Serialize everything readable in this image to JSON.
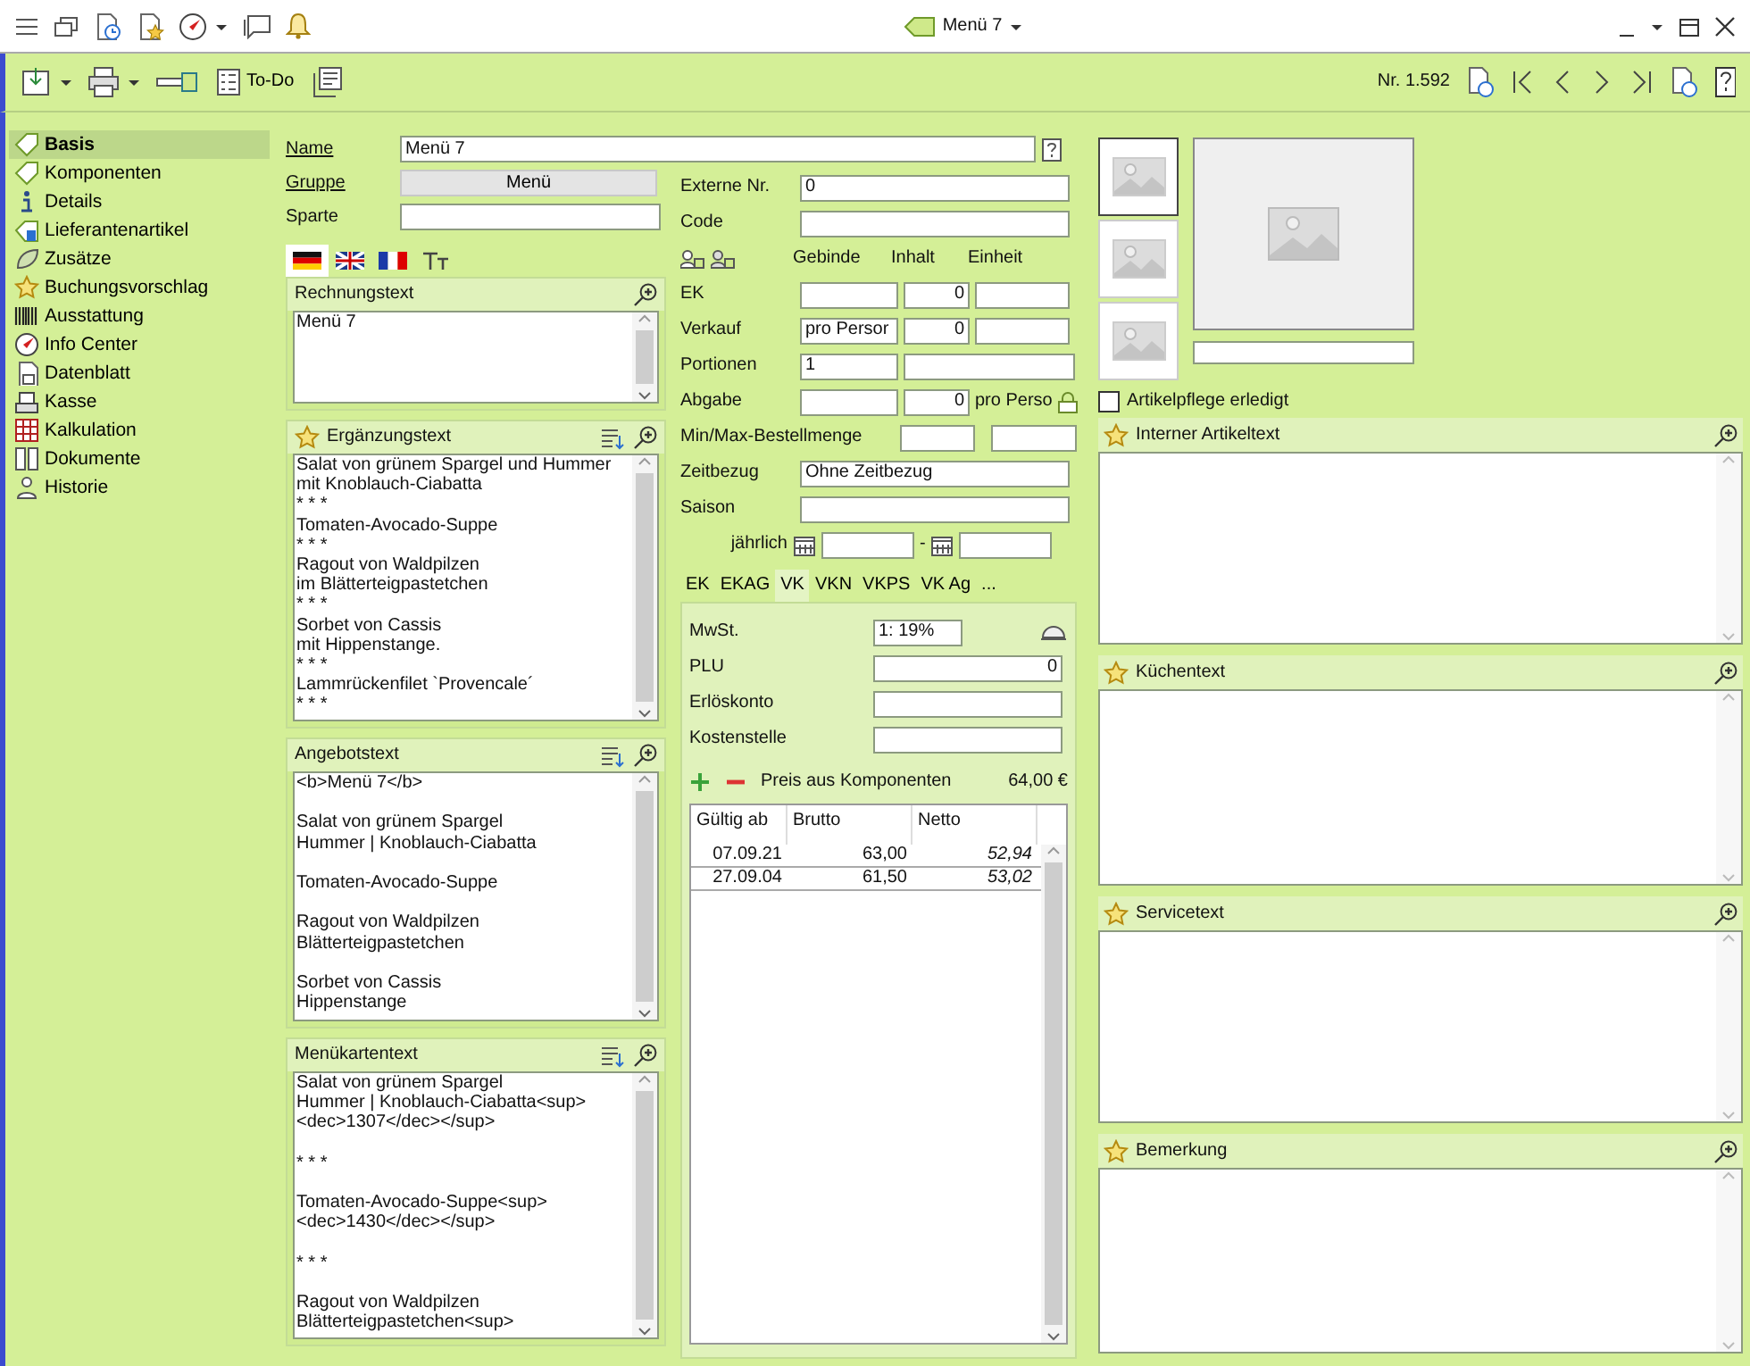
{
  "title_bar": {
    "title": "Menü 7"
  },
  "toolbar": {
    "todo_label": "To-Do",
    "record_number": "Nr. 1.592"
  },
  "sidebar": {
    "items": [
      {
        "label": "Basis",
        "kind": "tag",
        "selected": true
      },
      {
        "label": "Komponenten",
        "kind": "tag",
        "selected": false
      },
      {
        "label": "Details",
        "kind": "info",
        "selected": false
      },
      {
        "label": "Lieferantenartikel",
        "kind": "supplier",
        "selected": false
      },
      {
        "label": "Zusätze",
        "kind": "leaf",
        "selected": false
      },
      {
        "label": "Buchungsvorschlag",
        "kind": "star",
        "selected": false
      },
      {
        "label": "Ausstattung",
        "kind": "barcode",
        "selected": false
      },
      {
        "label": "Info Center",
        "kind": "compass",
        "selected": false
      },
      {
        "label": "Datenblatt",
        "kind": "sheet",
        "selected": false
      },
      {
        "label": "Kasse",
        "kind": "register",
        "selected": false
      },
      {
        "label": "Kalkulation",
        "kind": "grid",
        "selected": false
      },
      {
        "label": "Dokumente",
        "kind": "docs",
        "selected": false
      },
      {
        "label": "Historie",
        "kind": "history",
        "selected": false
      }
    ]
  },
  "form": {
    "name": {
      "label": "Name",
      "value": "Menü 7"
    },
    "group": {
      "label": "Gruppe",
      "value": "Menü"
    },
    "sparte": {
      "label": "Sparte"
    }
  },
  "language_tabs": [
    {
      "kind": "de",
      "selected": true
    },
    {
      "kind": "gb",
      "selected": false
    },
    {
      "kind": "fr",
      "selected": false
    },
    {
      "kind": "font",
      "selected": false
    }
  ],
  "text_panels": [
    {
      "title": "Rechnungstext",
      "starred": false,
      "sortable": false,
      "paragraphs": [
        [
          "Menü 7"
        ]
      ]
    },
    {
      "title": "Ergänzungstext",
      "starred": true,
      "sortable": true,
      "paragraphs": [
        [
          "Salat von grünem Spargel und Hummer",
          "mit Knoblauch-Ciabatta",
          "* * *",
          "Tomaten-Avocado-Suppe",
          "* * *",
          "Ragout von Waldpilzen",
          "im Blätterteigpastetchen",
          "* * *",
          "Sorbet von Cassis",
          "mit Hippenstange.",
          "* * *",
          "Lammrückenfilet `Provencale´",
          "* * *"
        ]
      ]
    },
    {
      "title": "Angebotstext",
      "starred": false,
      "sortable": true,
      "paragraphs": [
        [
          "<b>Menü 7</b>"
        ],
        [
          "Salat von grünem Spargel",
          "Hummer | Knoblauch-Ciabatta"
        ],
        [
          "Tomaten-Avocado-Suppe"
        ],
        [
          "Ragout von Waldpilzen",
          "Blätterteigpastetchen"
        ],
        [
          "Sorbet von Cassis",
          "Hippenstange"
        ]
      ]
    },
    {
      "title": "Menükartentext",
      "starred": false,
      "sortable": true,
      "paragraphs": [
        [
          "Salat von grünem Spargel",
          "Hummer | Knoblauch-Ciabatta<sup>",
          "<dec>1307</dec></sup>"
        ],
        [
          "* * *"
        ],
        [
          "Tomaten-Avocado-Suppe<sup>",
          "<dec>1430</dec></sup>"
        ],
        [
          "* * *"
        ],
        [
          "Ragout von Waldpilzen",
          "Blätterteigpastetchen<sup>"
        ]
      ]
    }
  ],
  "details": {
    "rows": [
      {
        "kind": "field",
        "label": "Externe Nr.",
        "value": "0"
      },
      {
        "kind": "field",
        "label": "Code"
      },
      {
        "kind": "header",
        "columns": [
          "Gebinde",
          "Inhalt",
          "Einheit"
        ]
      },
      {
        "kind": "measure",
        "label": "EK",
        "fields": [
          {
            "kind": "text"
          },
          {
            "kind": "number",
            "value": "0"
          },
          {
            "kind": "text"
          }
        ]
      },
      {
        "kind": "measure",
        "label": "Verkauf",
        "fields": [
          {
            "kind": "text",
            "value": "pro Persor"
          },
          {
            "kind": "number",
            "value": "0"
          },
          {
            "kind": "text"
          }
        ]
      },
      {
        "kind": "measure",
        "label": "Portionen",
        "fields": [
          {
            "kind": "text",
            "value": "1"
          },
          {
            "kind": "wide"
          }
        ]
      },
      {
        "kind": "measure",
        "label": "Abgabe",
        "fields": [
          {
            "kind": "text"
          },
          {
            "kind": "number",
            "value": "0"
          }
        ],
        "suffix": "pro Perso",
        "locked": true
      },
      {
        "kind": "minmax",
        "label": "Min/Max-Bestellmenge"
      },
      {
        "kind": "field",
        "label": "Zeitbezug",
        "value": "Ohne Zeitbezug"
      },
      {
        "kind": "field",
        "label": "Saison"
      },
      {
        "kind": "daterange",
        "label": "jährlich",
        "separator": "-"
      }
    ]
  },
  "price_tabs": [
    {
      "label": "EK",
      "selected": false
    },
    {
      "label": "EKAG",
      "selected": false
    },
    {
      "label": "VK",
      "selected": true
    },
    {
      "label": "VKN",
      "selected": false
    },
    {
      "label": "VKPS",
      "selected": false
    },
    {
      "label": "VK Ag",
      "selected": false
    },
    {
      "label": "...",
      "selected": false
    }
  ],
  "price_panel": {
    "fields": [
      {
        "label": "MwSt.",
        "kind": "select",
        "value": "1: 19%"
      },
      {
        "label": "PLU",
        "kind": "number",
        "value": "0"
      },
      {
        "label": "Erlöskonto",
        "kind": "text"
      },
      {
        "label": "Kostenstelle",
        "kind": "text"
      }
    ],
    "component_price_label": "Preis aus Komponenten",
    "component_price": "64,00 €",
    "table": {
      "columns": [
        "Gültig ab",
        "Brutto",
        "Netto"
      ],
      "rows": [
        [
          "07.09.21",
          "63,00",
          "52,94"
        ],
        [
          "27.09.04",
          "61,50",
          "53,02"
        ]
      ]
    }
  },
  "images": {
    "thumbnails": [
      {
        "selected": true
      },
      {
        "selected": false
      },
      {
        "selected": false
      }
    ]
  },
  "maintenance": {
    "label": "Artikelpflege erledigt",
    "checked": false
  },
  "note_panels": [
    {
      "title": "Interner Artikeltext"
    },
    {
      "title": "Küchentext"
    },
    {
      "title": "Servicetext"
    },
    {
      "title": "Bemerkung"
    }
  ]
}
